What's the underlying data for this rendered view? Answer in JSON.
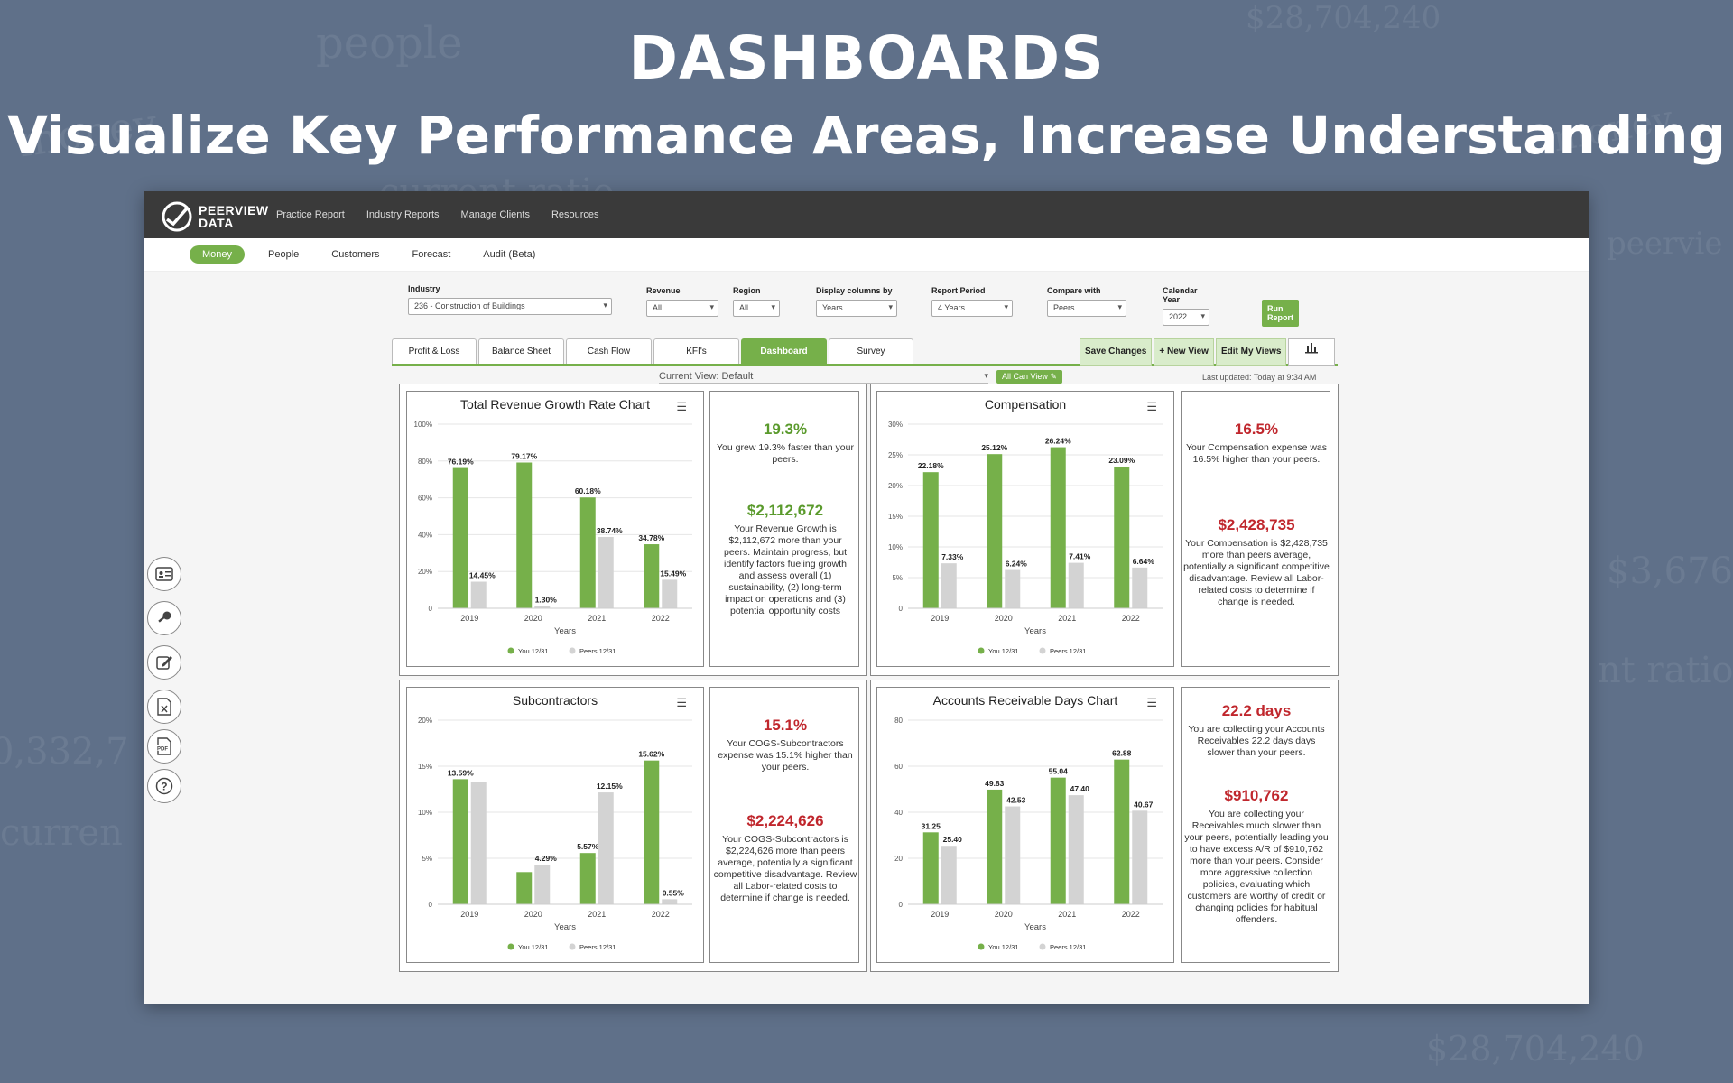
{
  "hero": {
    "title": "DASHBOARDS",
    "subtitle": "Visualize Key Performance Areas, Increase Understanding"
  },
  "app": {
    "logo_line1": "PEERVIEW",
    "logo_line2": "DATA",
    "nav": [
      "Practice Report",
      "Industry Reports",
      "Manage Clients",
      "Resources"
    ],
    "subnav": [
      "Money",
      "People",
      "Customers",
      "Forecast",
      "Audit (Beta)"
    ],
    "filters": {
      "industry": {
        "label": "Industry",
        "value": "236 - Construction of Buildings"
      },
      "revenue": {
        "label": "Revenue",
        "value": "All"
      },
      "region": {
        "label": "Region",
        "value": "All"
      },
      "display": {
        "label": "Display columns by",
        "value": "Years"
      },
      "period": {
        "label": "Report Period",
        "value": "4 Years"
      },
      "compare": {
        "label": "Compare with",
        "value": "Peers"
      },
      "year": {
        "label": "Calendar Year",
        "value": "2022"
      },
      "run_label": "Run Report"
    },
    "tabs": [
      "Profit & Loss",
      "Balance Sheet",
      "Cash Flow",
      "KFI's",
      "Dashboard",
      "Survey"
    ],
    "actions": [
      "Save Changes",
      "+ New View",
      "Edit My Views"
    ],
    "current_view": "Current View: Default",
    "all_can_view": "All Can View",
    "last_updated": "Last updated: Today at 9:34 AM",
    "side_icons": [
      "id-card-icon",
      "key-icon",
      "edit-icon",
      "excel-file-icon",
      "pdf-file-icon",
      "help-icon"
    ]
  },
  "colors": {
    "you": "#76b04a",
    "peers": "#d3d3d3",
    "good": "#5a9a2c",
    "bad": "#c0272d"
  },
  "chart_data": [
    {
      "type": "bar",
      "title": "Total Revenue Growth Rate Chart",
      "categories": [
        "2019",
        "2020",
        "2021",
        "2022"
      ],
      "xlabel": "Years",
      "ylim": [
        0,
        100
      ],
      "yticks": [
        "0",
        "20%",
        "40%",
        "60%",
        "80%",
        "100%"
      ],
      "series": [
        {
          "name": "You 12/31",
          "values": [
            76.19,
            79.17,
            60.18,
            34.78
          ],
          "labels": [
            "76.19%",
            "79.17%",
            "60.18%",
            "34.78%"
          ]
        },
        {
          "name": "Peers 12/31",
          "values": [
            14.45,
            1.3,
            38.74,
            15.49
          ],
          "labels": [
            "14.45%",
            "1.30%",
            "38.74%",
            "15.49%"
          ]
        }
      ]
    },
    {
      "type": "bar",
      "title": "Compensation",
      "categories": [
        "2019",
        "2020",
        "2021",
        "2022"
      ],
      "xlabel": "Years",
      "ylim": [
        0,
        30
      ],
      "yticks": [
        "0",
        "5%",
        "10%",
        "15%",
        "20%",
        "25%",
        "30%"
      ],
      "series": [
        {
          "name": "You 12/31",
          "values": [
            22.18,
            25.12,
            26.24,
            23.09
          ],
          "labels": [
            "22.18%",
            "25.12%",
            "26.24%",
            "23.09%"
          ]
        },
        {
          "name": "Peers 12/31",
          "values": [
            7.33,
            6.24,
            7.41,
            6.64
          ],
          "labels": [
            "7.33%",
            "6.24%",
            "7.41%",
            "6.64%"
          ]
        }
      ]
    },
    {
      "type": "bar",
      "title": "Subcontractors",
      "categories": [
        "2019",
        "2020",
        "2021",
        "2022"
      ],
      "xlabel": "Years",
      "ylim": [
        0,
        20
      ],
      "yticks": [
        "0",
        "5%",
        "10%",
        "15%",
        "20%"
      ],
      "series": [
        {
          "name": "You 12/31",
          "values": [
            13.59,
            3.5,
            5.57,
            15.62
          ],
          "labels": [
            "13.59%",
            "",
            "5.57%",
            "15.62%"
          ]
        },
        {
          "name": "Peers 12/31",
          "values": [
            13.3,
            4.29,
            12.15,
            0.55
          ],
          "labels": [
            "",
            "4.29%",
            "12.15%",
            "0.55%"
          ]
        }
      ]
    },
    {
      "type": "bar",
      "title": "Accounts Receivable Days Chart",
      "categories": [
        "2019",
        "2020",
        "2021",
        "2022"
      ],
      "xlabel": "Years",
      "ylim": [
        0,
        80
      ],
      "yticks": [
        "0",
        "20",
        "40",
        "60",
        "80"
      ],
      "series": [
        {
          "name": "You 12/31",
          "values": [
            31.25,
            49.83,
            55.04,
            62.88
          ],
          "labels": [
            "31.25",
            "49.83",
            "55.04",
            "62.88"
          ]
        },
        {
          "name": "Peers 12/31",
          "values": [
            25.4,
            42.53,
            47.4,
            40.67
          ],
          "labels": [
            "25.40",
            "42.53",
            "47.40",
            "40.67"
          ]
        }
      ]
    }
  ],
  "stats": [
    {
      "big1": "19.3%",
      "txt1": "You grew 19.3% faster than your peers.",
      "big2": "$2,112,672",
      "txt2": "Your Revenue Growth is $2,112,672 more than your peers. Maintain progress, but identify factors fueling growth and assess overall (1) sustainability, (2) long-term impact on operations and (3) potential opportunity costs",
      "tone": "good"
    },
    {
      "big1": "16.5%",
      "txt1": "Your Compensation expense was 16.5% higher than your peers.",
      "big2": "$2,428,735",
      "txt2": "Your Compensation is $2,428,735 more than peers average, potentially a significant competitive disadvantage. Review all Labor-related costs to determine if change is needed.",
      "tone": "bad"
    },
    {
      "big1": "15.1%",
      "txt1": "Your COGS-Subcontractors expense was 15.1% higher than your peers.",
      "big2": "$2,224,626",
      "txt2": "Your COGS-Subcontractors is $2,224,626 more than peers average, potentially a significant competitive disadvantage. Review all Labor-related costs to determine if change is needed.",
      "tone": "bad"
    },
    {
      "big1": "22.2 days",
      "txt1": "You are collecting your Accounts Receivables 22.2 days days slower than your peers.",
      "big2": "$910,762",
      "txt2": "You are collecting your Receivables much slower than your peers, potentially leading you to have excess A/R of $910,762 more than your peers. Consider more aggressive collection policies, evaluating which customers are worthy of credit or changing policies for habitual offenders.",
      "tone": "bad"
    }
  ]
}
